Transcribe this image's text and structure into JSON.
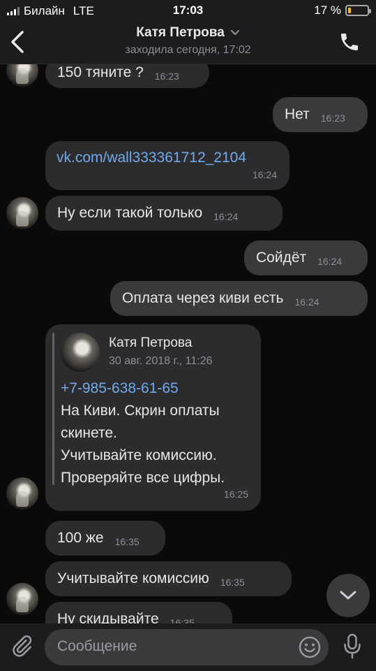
{
  "status_bar": {
    "carrier": "Билайн",
    "network": "LTE",
    "time": "17:03",
    "battery_percent": "17 %",
    "battery_level": 0.17
  },
  "header": {
    "title": "Катя Петрова",
    "subtitle": "заходила сегодня, 17:02"
  },
  "messages": [
    {
      "text": "150 тяните ?",
      "time": "16:23"
    },
    {
      "text": "Нет",
      "time": "16:23"
    },
    {
      "text": "vk.com/wall333361712_2104",
      "time": "16:24"
    },
    {
      "text": "Ну если такой только",
      "time": "16:24"
    },
    {
      "text": "Сойдёт",
      "time": "16:24"
    },
    {
      "text": "Оплата через киви есть",
      "time": "16:24"
    },
    {
      "text": "100 же",
      "time": "16:35"
    },
    {
      "text": "Учитывайте комиссию",
      "time": "16:35"
    },
    {
      "text": "Ну скидывайте",
      "time": "16:35"
    }
  ],
  "forwarded": {
    "author": "Катя Петрова",
    "date": "30 авг. 2018 г., 11:26",
    "phone": "+7-985-638-61-65",
    "lines": [
      "На Киви. Скрин оплаты",
      "скинете.",
      "Учитывайте комиссию.",
      "Проверяйте все цифры."
    ],
    "time": "16:25"
  },
  "composer": {
    "placeholder": "Сообщение"
  },
  "colors": {
    "background": "#0a0a0a",
    "bar": "#1c1c1e",
    "bubble_in": "#2c2c2e",
    "bubble_out": "#3a3a3c",
    "link": "#71aaeb",
    "battery": "#f2c200"
  },
  "icons": [
    "back-chevron-icon",
    "chevron-down-icon",
    "phone-icon",
    "paperclip-icon",
    "emoji-icon",
    "microphone-icon",
    "scroll-down-icon"
  ]
}
